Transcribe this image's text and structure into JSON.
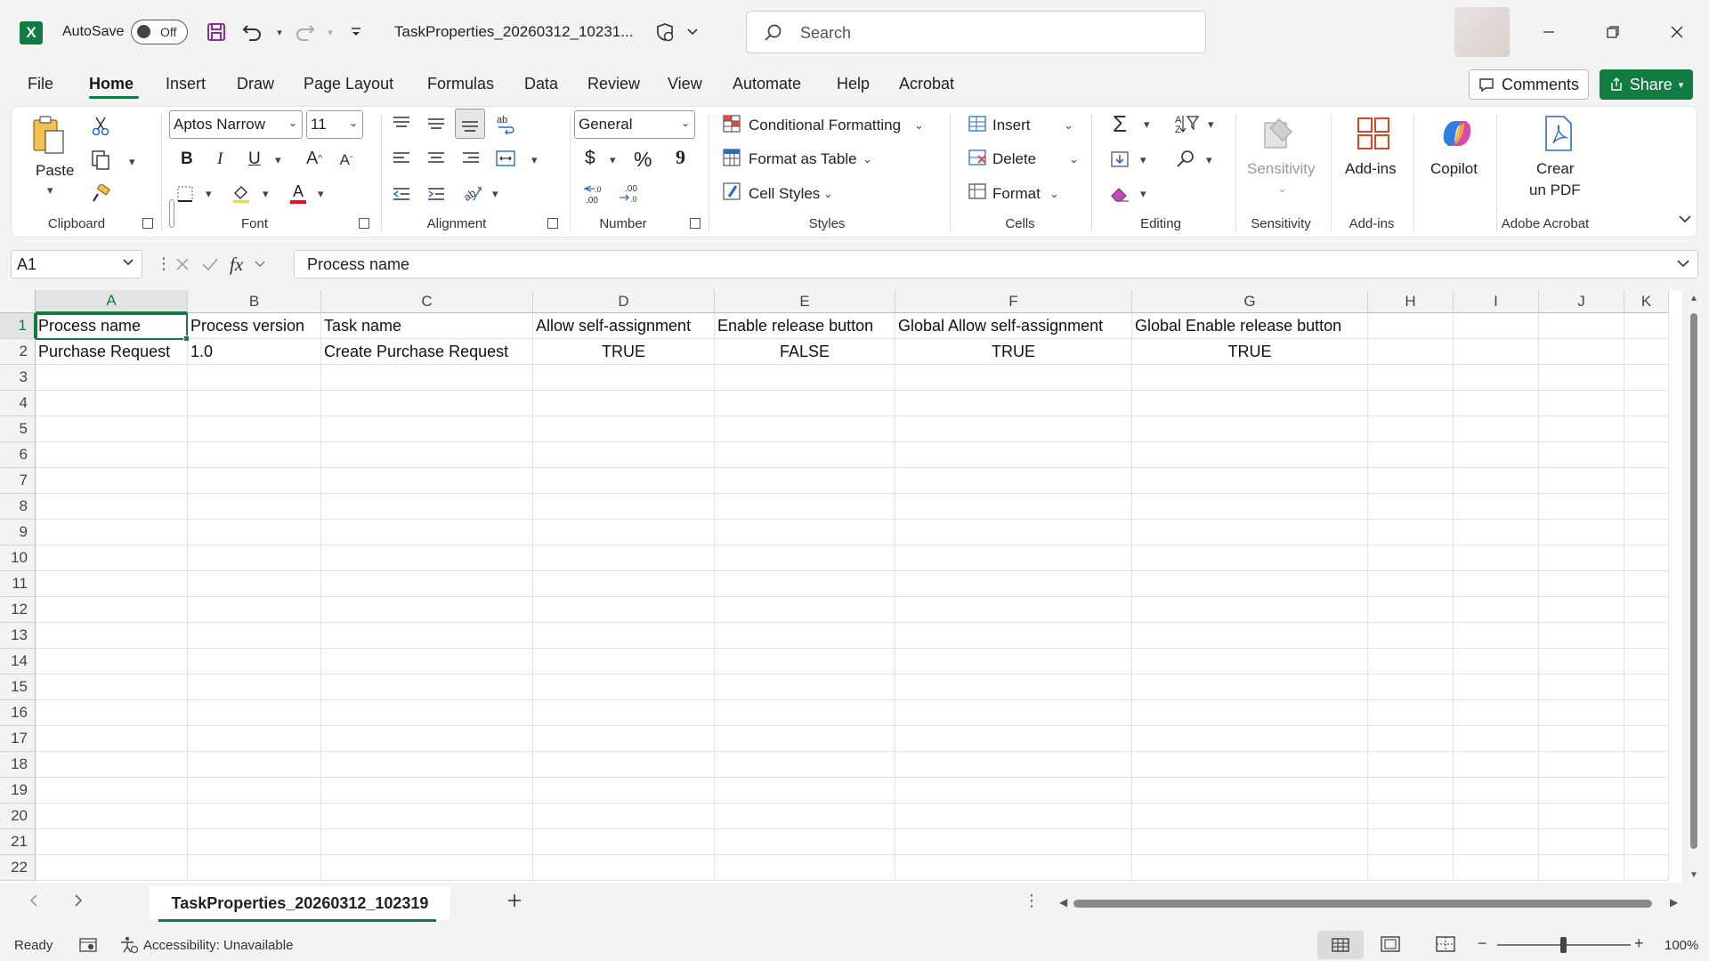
{
  "titlebar": {
    "autosave_label": "AutoSave",
    "autosave_state": "Off",
    "filename": "TaskProperties_20260312_10231...",
    "search_placeholder": "Search"
  },
  "menu": {
    "tabs": [
      "File",
      "Home",
      "Insert",
      "Draw",
      "Page Layout",
      "Formulas",
      "Data",
      "Review",
      "View",
      "Automate",
      "Help",
      "Acrobat"
    ],
    "active_tab": "Home",
    "comments_label": "Comments",
    "share_label": "Share"
  },
  "ribbon": {
    "clipboard": {
      "label": "Clipboard",
      "paste": "Paste"
    },
    "font": {
      "label": "Font",
      "font_name": "Aptos Narrow",
      "font_size": "11",
      "bold": "B",
      "italic": "I",
      "underline": "U"
    },
    "alignment": {
      "label": "Alignment"
    },
    "number": {
      "label": "Number",
      "format": "General",
      "currency": "$",
      "percent": "%",
      "comma": "9",
      "inc_decimal_top": ".0",
      "inc_decimal_bottom": ".00",
      "dec_decimal_top": ".00",
      "dec_decimal_bottom": "→.0"
    },
    "styles": {
      "label": "Styles",
      "conditional": "Conditional Formatting",
      "format_table": "Format as Table",
      "cell_styles": "Cell Styles"
    },
    "cells": {
      "label": "Cells",
      "insert": "Insert",
      "delete": "Delete",
      "format": "Format"
    },
    "editing": {
      "label": "Editing"
    },
    "sensitivity": {
      "label": "Sensitivity",
      "button": "Sensitivity"
    },
    "addins": {
      "label": "Add-ins",
      "button": "Add-ins"
    },
    "copilot": {
      "button": "Copilot"
    },
    "acrobat": {
      "label": "Adobe Acrobat",
      "button_line1": "Crear",
      "button_line2": "un PDF"
    }
  },
  "formula_bar": {
    "name_box": "A1",
    "fx": "fx",
    "content": "Process name"
  },
  "grid": {
    "columns": [
      "A",
      "B",
      "C",
      "D",
      "E",
      "F",
      "G",
      "H",
      "I",
      "J",
      "K"
    ],
    "rows": [
      "1",
      "2",
      "3",
      "4",
      "5",
      "6",
      "7",
      "8",
      "9",
      "10",
      "11",
      "12",
      "13",
      "14",
      "15",
      "16",
      "17",
      "18",
      "19",
      "20",
      "21",
      "22"
    ],
    "data": [
      [
        "Process name",
        "Process version",
        "Task name",
        "Allow self-assignment",
        "Enable release button",
        "Global Allow self-assignment",
        "Global Enable release button"
      ],
      [
        "Purchase Request",
        "1.0",
        "Create Purchase Request",
        "TRUE",
        "FALSE",
        "TRUE",
        "TRUE"
      ]
    ]
  },
  "sheets": {
    "tabs": [
      "TaskProperties_20260312_102319"
    ]
  },
  "status": {
    "ready": "Ready",
    "accessibility": "Accessibility: Unavailable",
    "zoom": "100%"
  },
  "colors": {
    "accent": "#107c41",
    "font_color_bar": "#e81123"
  }
}
